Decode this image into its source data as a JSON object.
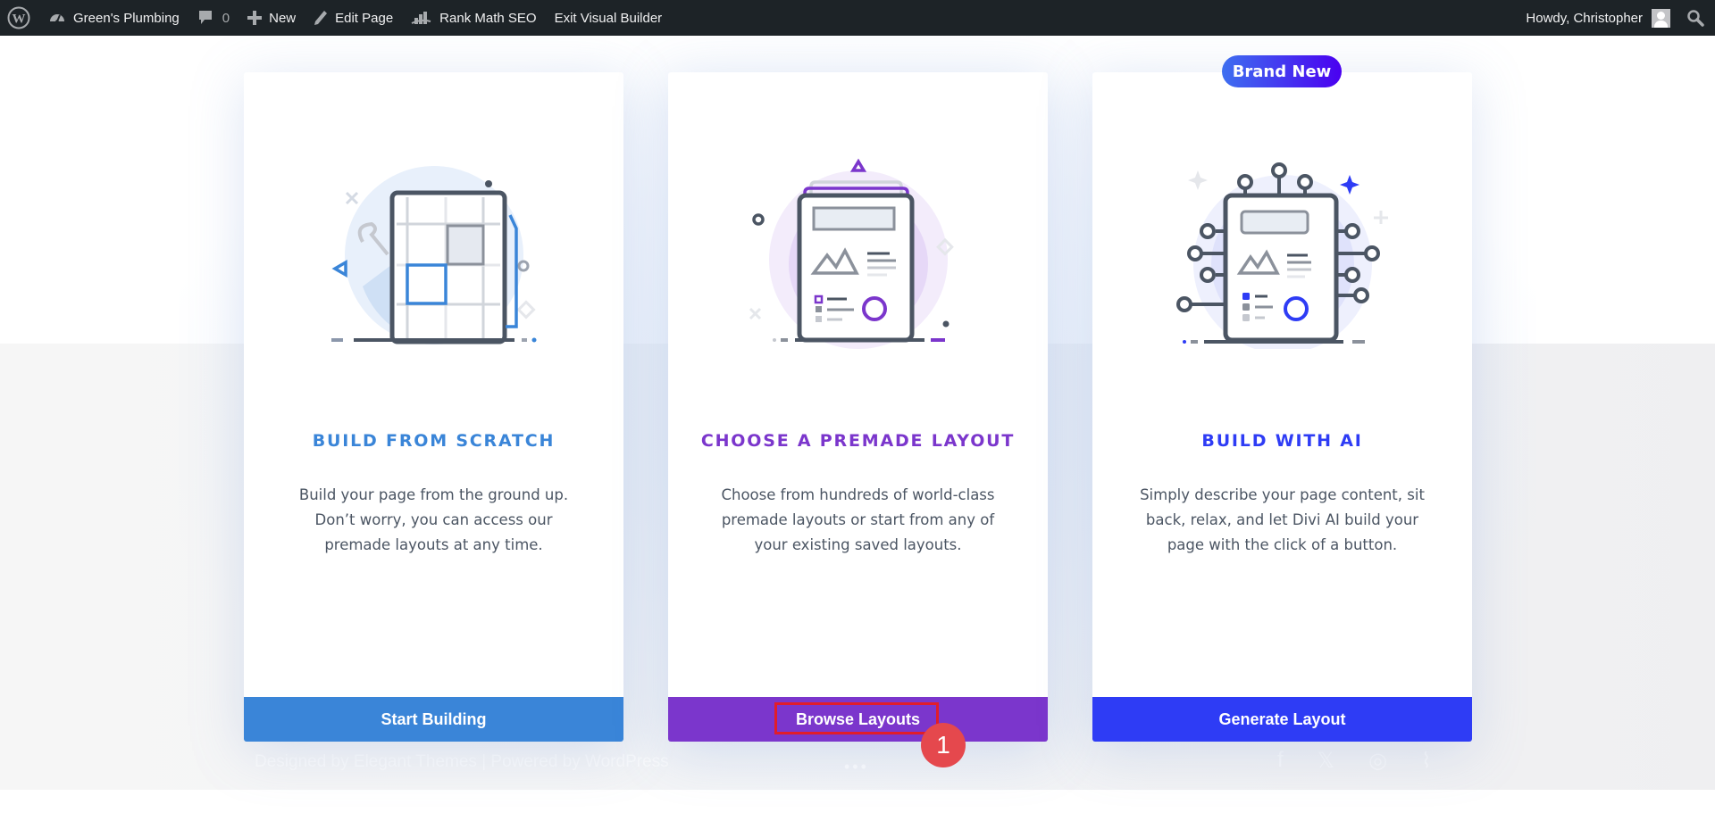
{
  "adminbar": {
    "items": [
      {
        "icon": "wordpress-logo-icon",
        "label": ""
      },
      {
        "icon": "dashboard-icon",
        "label": "Green's Plumbing"
      },
      {
        "icon": "comment-icon",
        "label": "",
        "count": "0"
      },
      {
        "icon": "plus-icon",
        "label": "New"
      },
      {
        "icon": "pencil-icon",
        "label": "Edit Page"
      },
      {
        "icon": "rank-math-icon",
        "label": "Rank Math SEO"
      },
      {
        "icon": "",
        "label": "Exit Visual Builder"
      }
    ],
    "greeting": "Howdy, Christopher",
    "search_icon": "search-icon"
  },
  "background": {
    "footer_credit": "Designed by Elegant Themes | Powered by WordPress",
    "social_icons": [
      "facebook-icon",
      "x-icon",
      "instagram-icon",
      "rss-icon"
    ]
  },
  "cards": [
    {
      "title": "BUILD FROM SCRATCH",
      "description": "Build your page from the ground up. Don’t worry, you can access our premade layouts at any time.",
      "button": "Start Building",
      "accent": "#3a85d8",
      "illustration": "grid-layout-illustration"
    },
    {
      "title": "CHOOSE A PREMADE LAYOUT",
      "description": "Choose from hundreds of world-class premade layouts or start from any of your existing saved layouts.",
      "button": "Browse Layouts",
      "accent": "#7b36cc",
      "illustration": "premade-layout-illustration"
    },
    {
      "title": "BUILD WITH AI",
      "description": "Simply describe your page content, sit back, relax, and let Divi AI build your page with the click of a button.",
      "button": "Generate Layout",
      "accent": "#2e3cf5",
      "illustration": "ai-circuit-illustration",
      "badge": "Brand New"
    }
  ],
  "annotation": {
    "step": "1",
    "target": "Browse Layouts"
  }
}
